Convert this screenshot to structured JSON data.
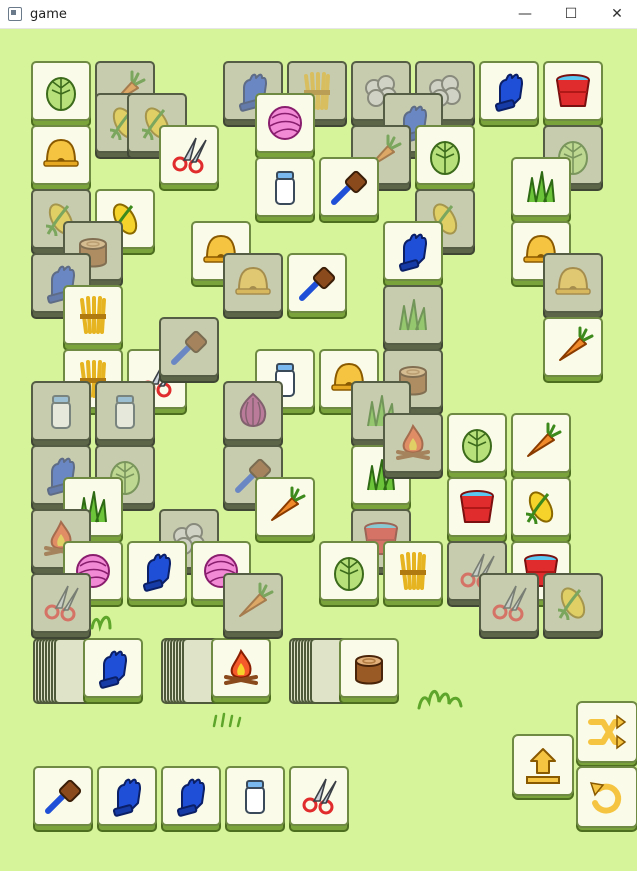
{
  "window": {
    "title": "game",
    "minimize_glyph": "—",
    "maximize_glyph": "☐",
    "close_glyph": "✕"
  },
  "icon_names": {
    "cabbage": "cabbage-icon",
    "carrot": "carrot-icon",
    "corn": "corn-icon",
    "bell": "bell-icon",
    "glove": "glove-icon",
    "bucket": "bucket-icon",
    "yarn": "yarn-ball-icon",
    "shears": "shears-icon",
    "milk": "milk-bottle-icon",
    "brush": "brush-icon",
    "grass": "grass-icon",
    "wheat": "wheat-bundle-icon",
    "stump": "tree-stump-icon",
    "fire": "campfire-icon",
    "onion": "onion-icon",
    "wool": "wool-ball-icon"
  },
  "colors": {
    "background": "#d6f59a",
    "tile_face": "#fbfbe9",
    "tile_side": "#7aa33c",
    "accent_yellow": "#f5c542",
    "accent_blue": "#1f4fd6",
    "accent_red": "#e02c2c"
  },
  "board_tiles": [
    {
      "type": "cabbage",
      "dim": false
    },
    {
      "type": "carrot",
      "dim": true
    },
    {
      "type": "glove",
      "dim": true
    },
    {
      "type": "wheat",
      "dim": true
    },
    {
      "type": "wool",
      "dim": true
    },
    {
      "type": "wool",
      "dim": true
    },
    {
      "type": "glove",
      "dim": false
    },
    {
      "type": "bucket",
      "dim": false
    },
    {
      "type": "corn",
      "dim": true
    },
    {
      "type": "corn",
      "dim": true
    },
    {
      "type": "yarn",
      "dim": false
    },
    {
      "type": "glove",
      "dim": true
    },
    {
      "type": "bell",
      "dim": false
    },
    {
      "type": "shears",
      "dim": false
    },
    {
      "type": "carrot",
      "dim": true
    },
    {
      "type": "cabbage",
      "dim": false
    },
    {
      "type": "cabbage",
      "dim": true
    },
    {
      "type": "milk",
      "dim": false
    },
    {
      "type": "brush",
      "dim": false
    },
    {
      "type": "grass",
      "dim": false
    },
    {
      "type": "corn",
      "dim": true
    },
    {
      "type": "corn",
      "dim": false
    },
    {
      "type": "stump",
      "dim": true
    },
    {
      "type": "bell",
      "dim": false
    },
    {
      "type": "corn",
      "dim": true
    },
    {
      "type": "glove",
      "dim": false
    },
    {
      "type": "bell",
      "dim": false
    },
    {
      "type": "glove",
      "dim": true
    },
    {
      "type": "brush",
      "dim": false
    },
    {
      "type": "bell",
      "dim": true
    },
    {
      "type": "bell",
      "dim": true
    },
    {
      "type": "wheat",
      "dim": false
    },
    {
      "type": "grass",
      "dim": true
    },
    {
      "type": "carrot",
      "dim": false
    },
    {
      "type": "wheat",
      "dim": false
    },
    {
      "type": "shears",
      "dim": false
    },
    {
      "type": "brush",
      "dim": true
    },
    {
      "type": "milk",
      "dim": false
    },
    {
      "type": "bell",
      "dim": false
    },
    {
      "type": "stump",
      "dim": true
    },
    {
      "type": "milk",
      "dim": true
    },
    {
      "type": "milk",
      "dim": true
    },
    {
      "type": "onion",
      "dim": true
    },
    {
      "type": "grass",
      "dim": true
    },
    {
      "type": "cabbage",
      "dim": false
    },
    {
      "type": "carrot",
      "dim": false
    },
    {
      "type": "glove",
      "dim": true
    },
    {
      "type": "cabbage",
      "dim": true
    },
    {
      "type": "brush",
      "dim": true
    },
    {
      "type": "grass",
      "dim": false
    },
    {
      "type": "fire",
      "dim": true
    },
    {
      "type": "grass",
      "dim": false
    },
    {
      "type": "carrot",
      "dim": false
    },
    {
      "type": "bucket",
      "dim": false
    },
    {
      "type": "corn",
      "dim": false
    },
    {
      "type": "fire",
      "dim": true
    },
    {
      "type": "wool",
      "dim": true
    },
    {
      "type": "bucket",
      "dim": true
    },
    {
      "type": "yarn",
      "dim": false
    },
    {
      "type": "glove",
      "dim": false
    },
    {
      "type": "yarn",
      "dim": false
    },
    {
      "type": "cabbage",
      "dim": false
    },
    {
      "type": "wheat",
      "dim": false
    },
    {
      "type": "shears",
      "dim": true
    },
    {
      "type": "bucket",
      "dim": false
    },
    {
      "type": "shears",
      "dim": true
    },
    {
      "type": "carrot",
      "dim": true
    },
    {
      "type": "shears",
      "dim": true
    },
    {
      "type": "corn",
      "dim": true
    }
  ],
  "stacks": [
    {
      "top": "glove"
    },
    {
      "top": "fire"
    },
    {
      "top": "stump"
    }
  ],
  "tray": [
    "brush",
    "glove",
    "glove",
    "milk",
    "shears"
  ],
  "controls": {
    "shuffle": "shuffle-icon",
    "undo": "undo-icon",
    "pop_out": "pop-out-icon"
  }
}
